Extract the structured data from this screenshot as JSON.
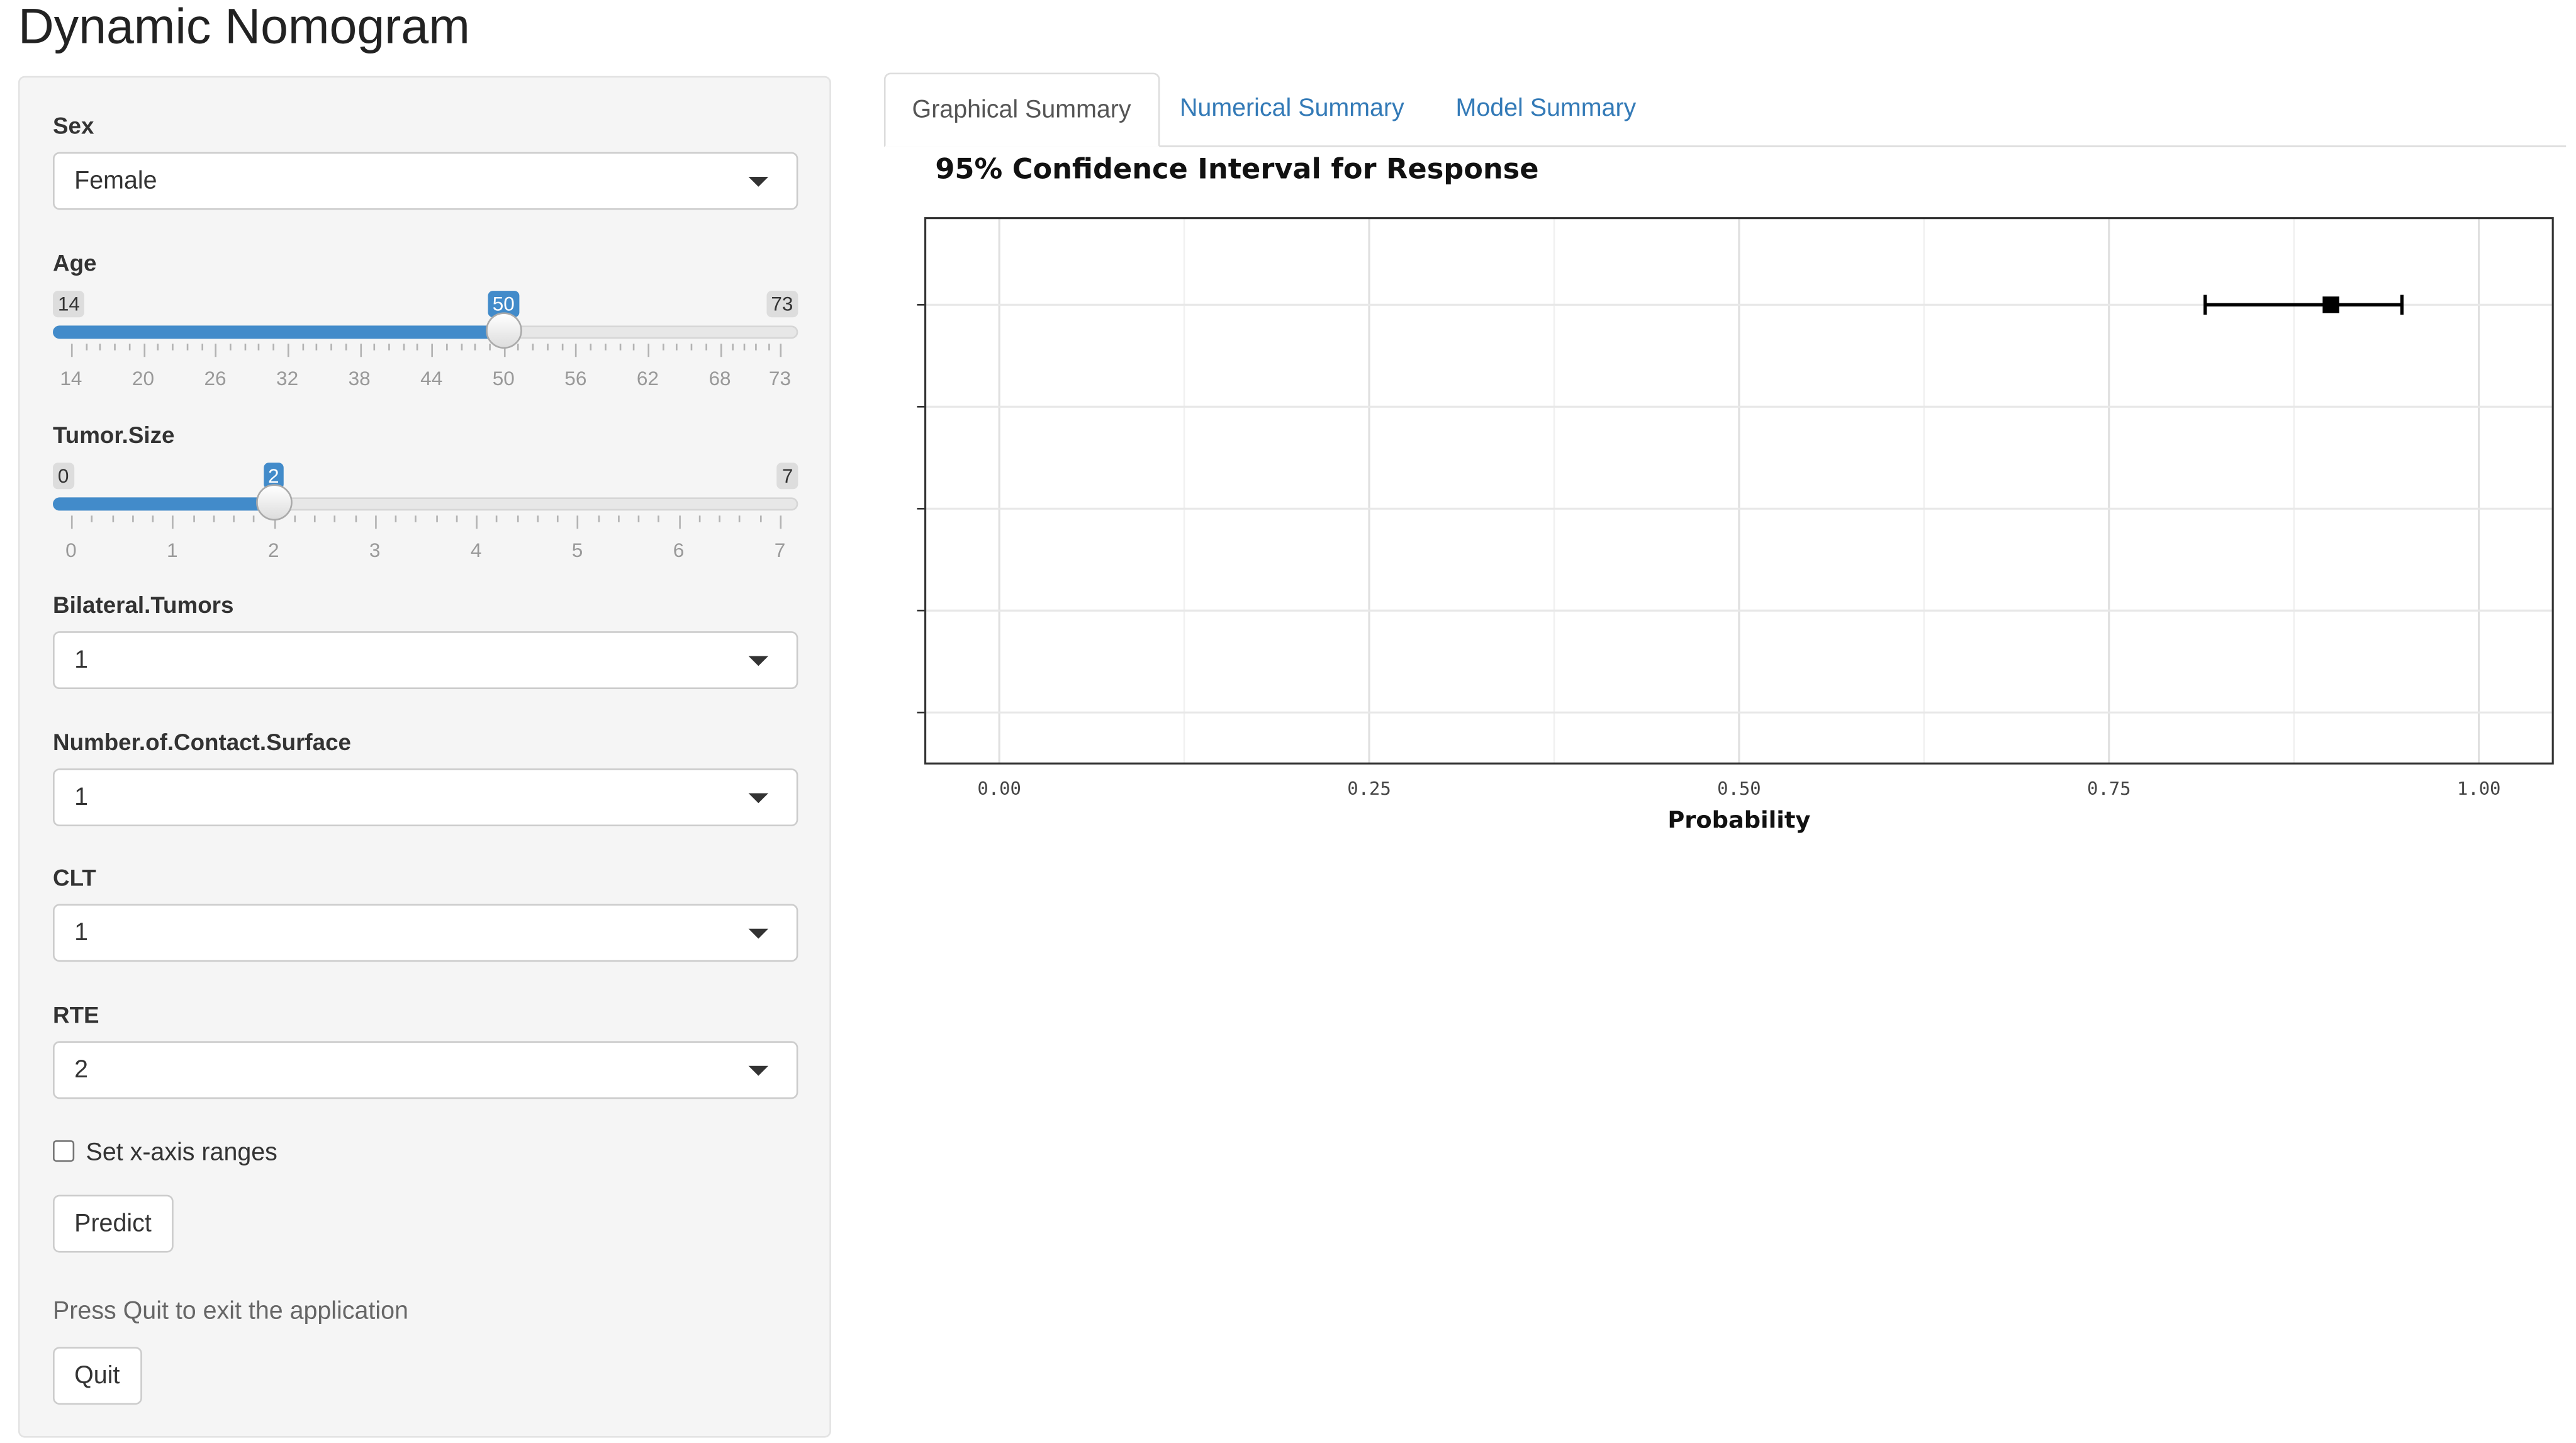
{
  "app": {
    "title": "Dynamic Nomogram"
  },
  "sidebar": {
    "sex": {
      "label": "Sex",
      "value": "Female"
    },
    "age": {
      "label": "Age",
      "min": 14,
      "max": 73,
      "value": 50,
      "min_label": "14",
      "max_label": "73",
      "value_label": "50",
      "ticks": [
        "14",
        "20",
        "26",
        "32",
        "38",
        "44",
        "50",
        "56",
        "62",
        "68",
        "73"
      ]
    },
    "tumor_size": {
      "label": "Tumor.Size",
      "min": 0,
      "max": 7,
      "value": 2,
      "min_label": "0",
      "max_label": "7",
      "value_label": "2",
      "ticks": [
        "0",
        "1",
        "2",
        "3",
        "4",
        "5",
        "6",
        "7"
      ]
    },
    "bilateral": {
      "label": "Bilateral.Tumors",
      "value": "1"
    },
    "contact": {
      "label": "Number.of.Contact.Surface",
      "value": "1"
    },
    "clt": {
      "label": "CLT",
      "value": "1"
    },
    "rte": {
      "label": "RTE",
      "value": "2"
    },
    "xrange_label": "Set x-axis ranges",
    "predict_label": "Predict",
    "quit_note": "Press Quit to exit the application",
    "quit_label": "Quit"
  },
  "tabs": [
    {
      "label": "Graphical Summary",
      "active": true
    },
    {
      "label": "Numerical Summary",
      "active": false
    },
    {
      "label": "Model Summary",
      "active": false
    }
  ],
  "chart_title": "95% Confidence Interval for Response",
  "chart_data": {
    "type": "scatter",
    "title": "95% Confidence Interval for Response",
    "xlabel": "Probability",
    "ylabel": "",
    "xlim": [
      -0.05,
      1.05
    ],
    "x_ticks": [
      "0.00",
      "0.25",
      "0.50",
      "0.75",
      "1.00"
    ],
    "y_rows": 5,
    "points": [
      {
        "row": 5,
        "estimate": 0.9,
        "lower": 0.815,
        "upper": 0.948
      }
    ],
    "grid": true
  },
  "colors": {
    "accent": "#428bca",
    "link": "#337ab7",
    "panel": "#f5f5f5"
  }
}
